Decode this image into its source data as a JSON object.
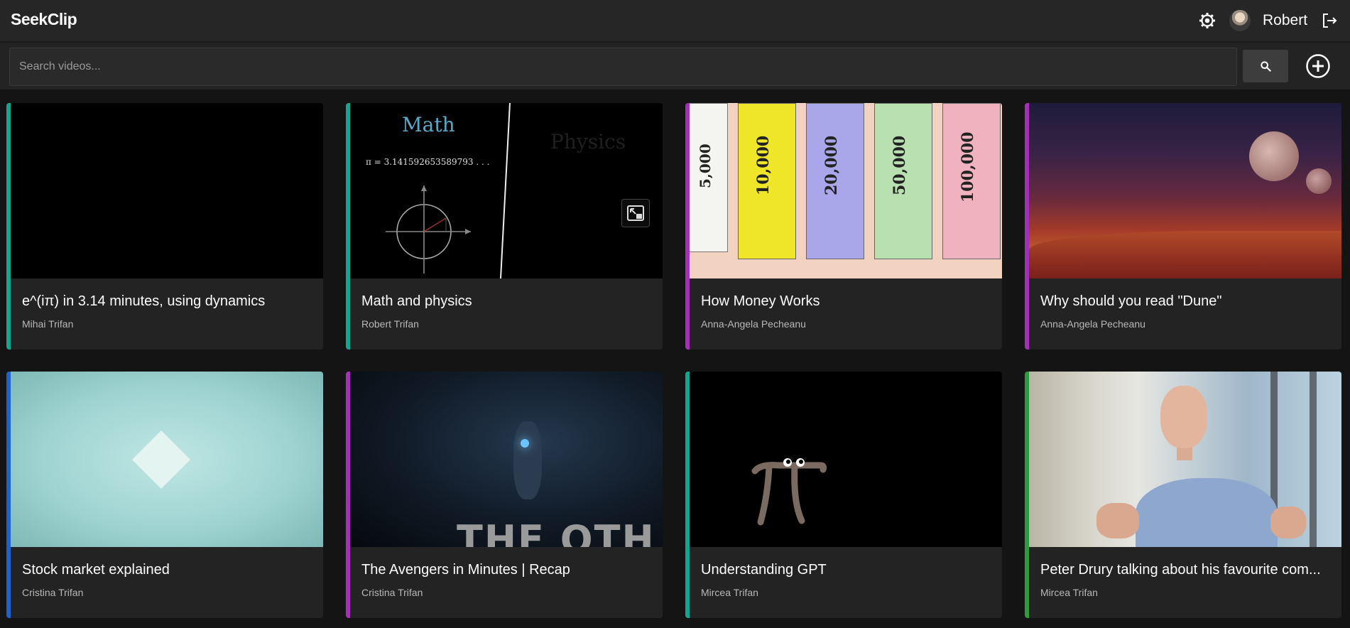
{
  "app": {
    "name": "SeekClip"
  },
  "header": {
    "username": "Robert",
    "icons": [
      "settings-gear-icon",
      "avatar",
      "logout-icon"
    ]
  },
  "search": {
    "placeholder": "Search videos...",
    "value": ""
  },
  "colors": {
    "teal": "#12a58f",
    "purple": "#a52fb8",
    "blue": "#1f63c9",
    "green": "#2e9a3e"
  },
  "videos": [
    {
      "title": "e^(iπ) in 3.14 minutes, using dynamics",
      "author": "Mihai Trifan",
      "accent": "#12a58f",
      "thumb": "black"
    },
    {
      "title": "Math and physics",
      "author": "Robert Trifan",
      "accent": "#12a58f",
      "thumb": "math",
      "thumb_text": {
        "heading": "Math",
        "formula": "π = 3.141592653589793 . . .",
        "faded": "Physics"
      }
    },
    {
      "title": "How Money Works",
      "author": "Anna-Angela Pecheanu",
      "accent": "#a52fb8",
      "thumb": "money",
      "thumb_text": {
        "notes": [
          "5,000",
          "10,000",
          "20,000",
          "50,000",
          "100,000"
        ]
      }
    },
    {
      "title": "Why should you read \"Dune\"",
      "author": "Anna-Angela Pecheanu",
      "accent": "#a52fb8",
      "thumb": "dune"
    },
    {
      "title": "Stock market explained",
      "author": "Cristina Trifan",
      "accent": "#1f63c9",
      "thumb": "stock"
    },
    {
      "title": "The Avengers in Minutes | Recap",
      "author": "Cristina Trifan",
      "accent": "#a52fb8",
      "thumb": "avengers",
      "thumb_text": {
        "overlay": "THE OTH"
      }
    },
    {
      "title": "Understanding GPT",
      "author": "Mircea Trifan",
      "accent": "#12a58f",
      "thumb": "pi"
    },
    {
      "title": "Peter Drury talking about his favourite com...",
      "author": "Mircea Trifan",
      "accent": "#2e9a3e",
      "thumb": "person"
    }
  ]
}
